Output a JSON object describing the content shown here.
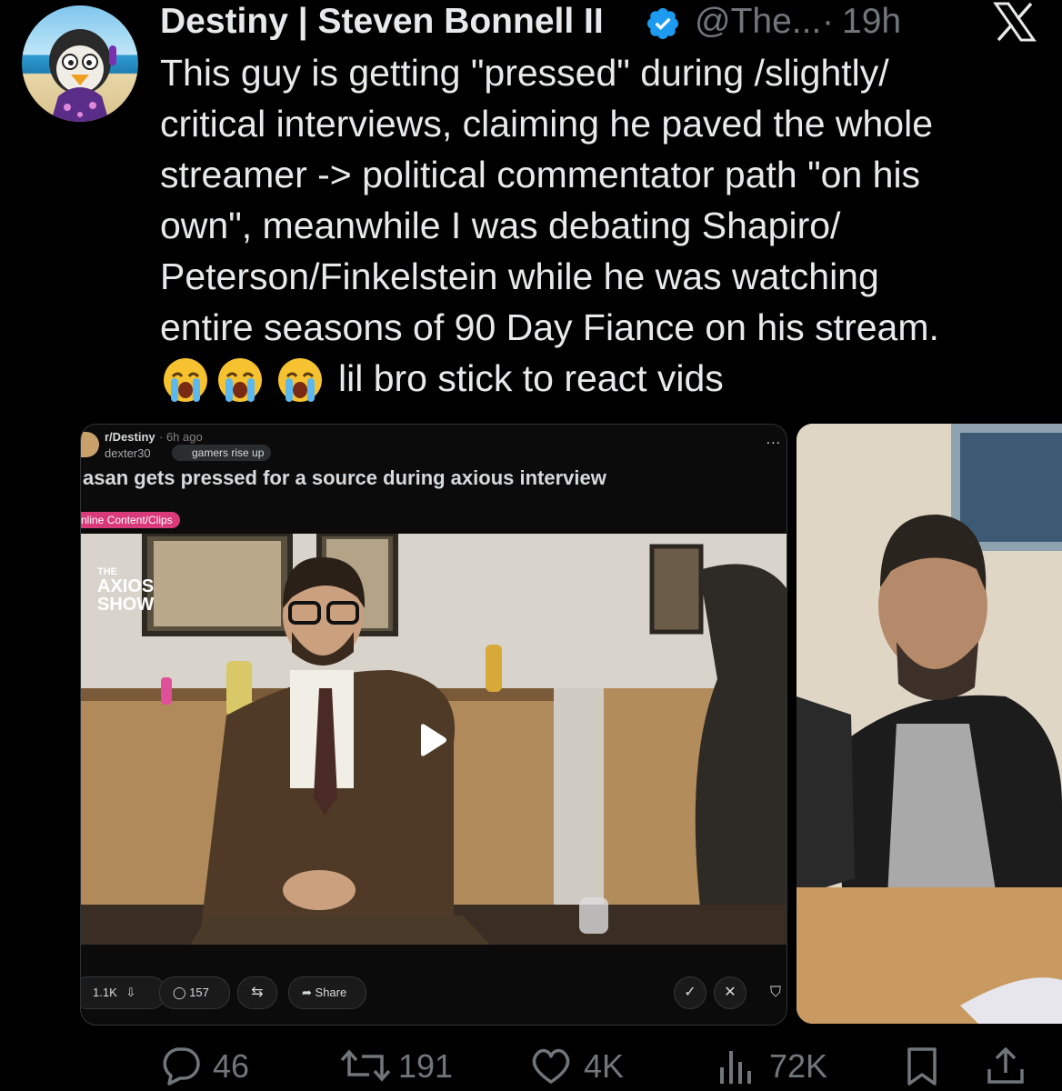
{
  "tweet": {
    "author_name": "Destiny | Steven Bonnell II",
    "handle": "@The...",
    "separator": "·",
    "time": "19h",
    "text": "This guy is getting \"pressed\" during /slightly/\ncritical interviews, claiming he paved the whole\nstreamer -> political commentator path \"on his\nown\", meanwhile I was debating Shapiro/\nPeterson/Finkelstein while he was watching\nentire seasons of 90 Day Fiance on his stream.",
    "emoji": "😭",
    "emoji_tail_text": "lil bro stick to react vids"
  },
  "embedded_reddit_post": {
    "subreddit": "r/Destiny",
    "posted_ago": "· 6h ago",
    "author": "dexter30",
    "user_flair": "gamers rise up",
    "more": "...",
    "title": "asan gets pressed for a source during axious interview",
    "post_flair": "nline Content/Clips",
    "video_overlay": {
      "line1": "THE",
      "line2": "AXIOS",
      "line3": "SHOW"
    },
    "actions": {
      "votes": "1.1K",
      "comments": "157",
      "share": "Share"
    }
  },
  "tweet_actions": {
    "replies": "46",
    "reposts": "191",
    "likes": "4K",
    "views": "72K"
  },
  "colors": {
    "background": "#000000",
    "text": "#e7e9ea",
    "muted": "#71767b",
    "verified": "#1d9bf0",
    "reddit_flair": "#d93a7a"
  }
}
